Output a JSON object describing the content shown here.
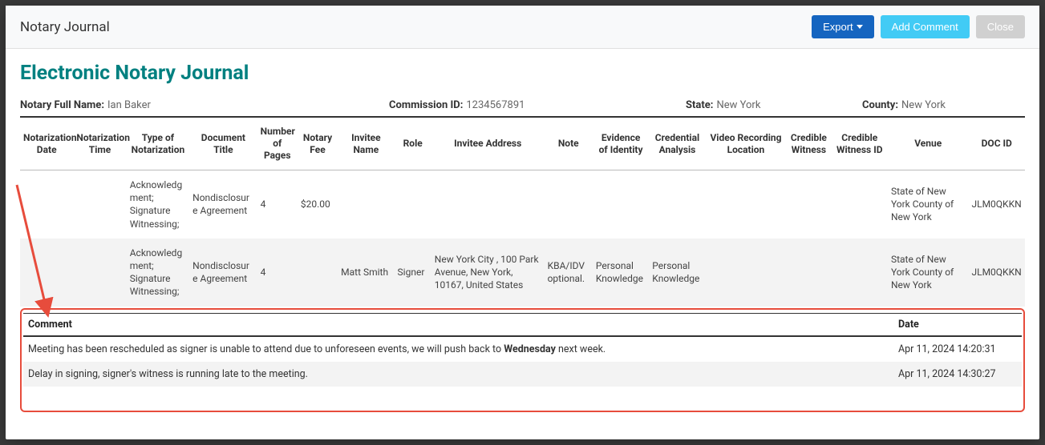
{
  "header": {
    "title": "Notary Journal",
    "export_label": "Export",
    "add_comment_label": "Add Comment",
    "close_label": "Close"
  },
  "page": {
    "title": "Electronic Notary Journal"
  },
  "meta": {
    "notary_label": "Notary Full Name:",
    "notary_value": "Ian Baker",
    "commission_label": "Commission ID:",
    "commission_value": "1234567891",
    "state_label": "State:",
    "state_value": "New York",
    "county_label": "County:",
    "county_value": "New York"
  },
  "columns": {
    "c0": "Notarization Date",
    "c1": "Notarization Time",
    "c2": "Type of Notarization",
    "c3": "Document Title",
    "c4": "Number of Pages",
    "c5": "Notary Fee",
    "c6": "Invitee Name",
    "c7": "Role",
    "c8": "Invitee Address",
    "c9": "Note",
    "c10": "Evidence of Identity",
    "c11": "Credential Analysis",
    "c12": "Video Recording Location",
    "c13": "Credible Witness",
    "c14": "Credible Witness ID",
    "c15": "Venue",
    "c16": "DOC ID"
  },
  "rows": [
    {
      "c0": "",
      "c1": "",
      "c2": "Acknowledgment; Signature Witnessing;",
      "c3": "Nondisclosure Agreement",
      "c4": "4",
      "c5": "$20.00",
      "c6": "",
      "c7": "",
      "c8": "",
      "c9": "",
      "c10": "",
      "c11": "",
      "c12": "",
      "c13": "",
      "c14": "",
      "c15": "State of New York County of New York",
      "c16": "JLM0QKKN"
    },
    {
      "c0": "",
      "c1": "",
      "c2": "Acknowledgment; Signature Witnessing;",
      "c3": "Nondisclosure Agreement",
      "c4": "4",
      "c5": "",
      "c6": "Matt  Smith",
      "c7": "Signer",
      "c8": "New York City , 100 Park Avenue, New York, 10167, United States",
      "c9": "KBA/IDV optional.",
      "c10": "Personal Knowledge",
      "c11": "Personal Knowledge",
      "c12": "",
      "c13": "",
      "c14": "",
      "c15": "State of New York County of New York",
      "c16": "JLM0QKKN"
    }
  ],
  "comments": {
    "col_comment": "Comment",
    "col_date": "Date",
    "items": [
      {
        "text_pre": "Meeting has been rescheduled as signer is unable to attend due to unforeseen events, we will push back to ",
        "text_bold": "Wednesday",
        "text_post": " next week.",
        "date": "Apr 11, 2024 14:20:31"
      },
      {
        "text_pre": "Delay in signing, signer's witness is running late to the meeting.",
        "text_bold": "",
        "text_post": "",
        "date": "Apr 11, 2024 14:30:27"
      }
    ]
  }
}
